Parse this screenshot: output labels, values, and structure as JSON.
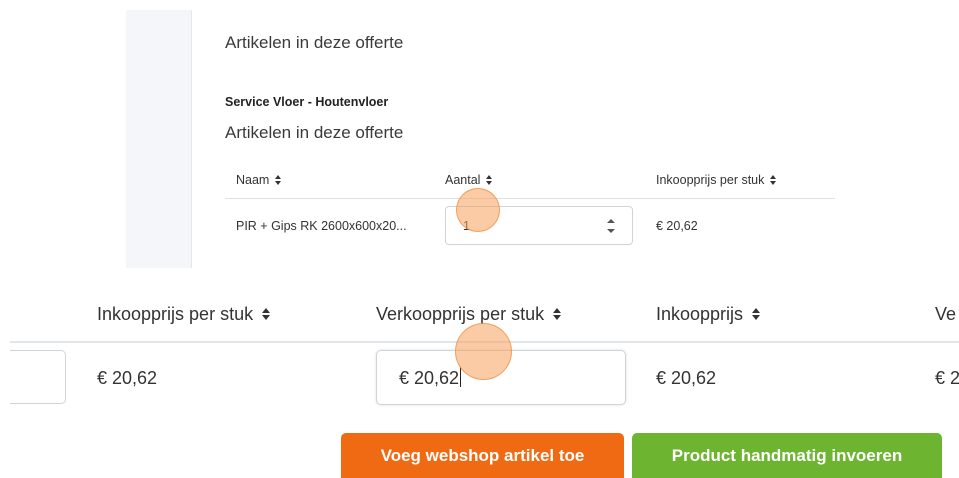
{
  "top": {
    "heading_1": "Artikelen in deze offerte",
    "section_label": "Service Vloer - Houtenvloer",
    "heading_2": "Artikelen in deze offerte",
    "columns": [
      "Naam",
      "Aantal",
      "Inkoopprijs per stuk"
    ],
    "row": {
      "naam": "PIR + Gips RK 2600x600x20...",
      "aantal": "1",
      "inkoopprijs_per_stuk": "€ 20,62"
    }
  },
  "bottom": {
    "columns": [
      "Inkoopprijs per stuk",
      "Verkoopprijs per stuk",
      "Inkoopprijs",
      "Ve"
    ],
    "row": {
      "inkoopprijs_per_stuk": "€ 20,62",
      "verkoopprijs_per_stuk": "€ 20,62",
      "inkoopprijs": "€ 20,62",
      "partial": "€ 2"
    },
    "buttons": {
      "webshop": "Voeg webshop artikel toe",
      "manual": "Product handmatig invoeren"
    }
  },
  "colors": {
    "orange_button": "#f06a13",
    "green_button": "#6db531",
    "click_highlight": "#f6a05a"
  },
  "icons": [
    "sort-icon",
    "spinner-icon"
  ]
}
